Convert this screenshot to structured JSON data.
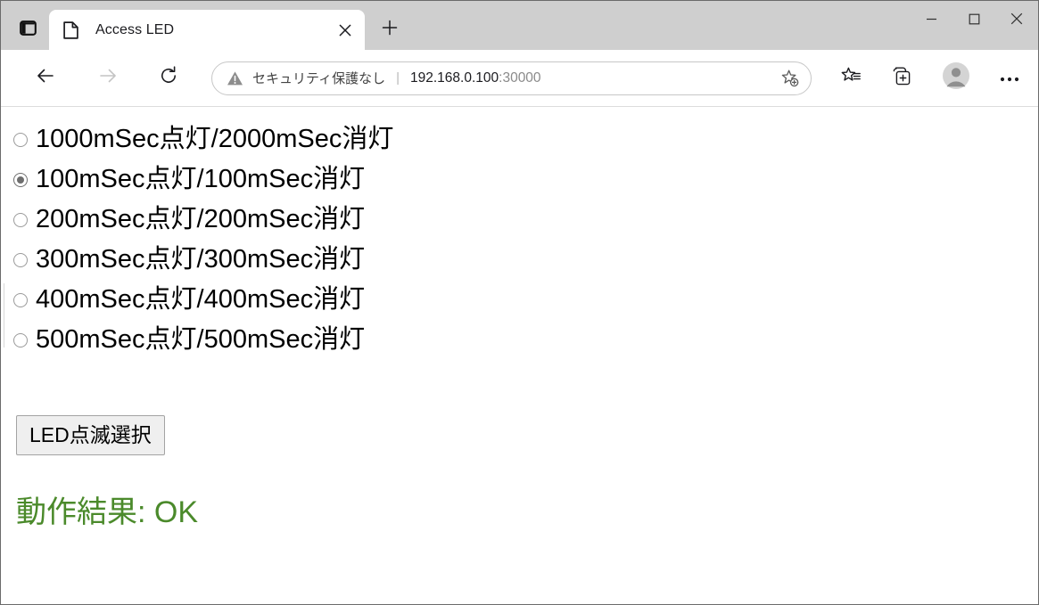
{
  "window": {
    "minimize_label": "—",
    "maximize_label": "□",
    "close_label": "✕"
  },
  "tabstrip": {
    "tab_actions_icon": "split-pane-icon",
    "tab": {
      "favicon": "document-icon",
      "title": "Access LED",
      "close_label": "✕"
    },
    "new_tab_label": "+"
  },
  "toolbar": {
    "back_icon": "arrow-left-icon",
    "forward_icon": "arrow-right-icon",
    "reload_icon": "reload-icon",
    "omnibox": {
      "security_icon": "warning-triangle-icon",
      "security_text": "セキュリティ保護なし",
      "separator": "|",
      "url_host": "192.168.0.100",
      "url_port": ":30000",
      "favorite_icon": "star-plus-icon"
    },
    "favorites_icon": "favorites-list-icon",
    "collections_icon": "collections-add-icon",
    "profile_icon": "profile-avatar-icon",
    "more_icon": "ellipsis-icon"
  },
  "page": {
    "radio_group_name": "led-blink-pattern",
    "options": [
      {
        "label": "1000mSec点灯/2000mSec消灯",
        "checked": false
      },
      {
        "label": "100mSec点灯/100mSec消灯",
        "checked": true
      },
      {
        "label": "200mSec点灯/200mSec消灯",
        "checked": false
      },
      {
        "label": "300mSec点灯/300mSec消灯",
        "checked": false
      },
      {
        "label": "400mSec点灯/400mSec消灯",
        "checked": false
      },
      {
        "label": "500mSec点灯/500mSec消灯",
        "checked": false
      }
    ],
    "submit_label": "LED点滅選択",
    "result_text": "動作結果: OK",
    "result_color": "#4b8a2b"
  }
}
